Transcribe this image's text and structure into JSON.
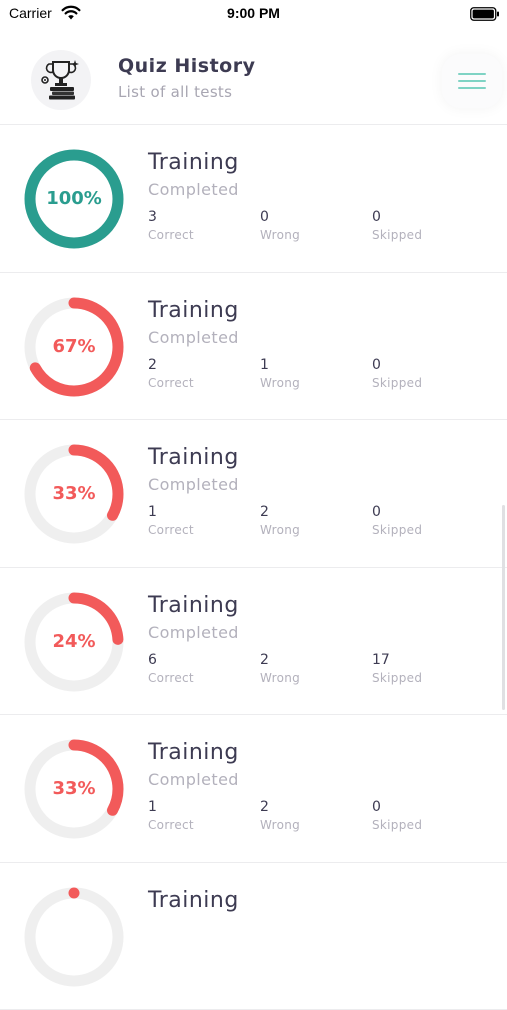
{
  "status": {
    "carrier": "Carrier",
    "time": "9:00 PM"
  },
  "header": {
    "title": "Quiz History",
    "subtitle": "List of all tests"
  },
  "colors": {
    "success": "#2a9d8f",
    "danger": "#f25a5a",
    "track": "#efefef",
    "menu": "#7fd3c4"
  },
  "labels": {
    "correct": "Correct",
    "wrong": "Wrong",
    "skipped": "Skipped"
  },
  "items": [
    {
      "title": "Training",
      "status": "Completed",
      "percent": "100%",
      "progress": 1.0,
      "correct": "3",
      "wrong": "0",
      "skipped": "0"
    },
    {
      "title": "Training",
      "status": "Completed",
      "percent": "67%",
      "progress": 0.67,
      "correct": "2",
      "wrong": "1",
      "skipped": "0"
    },
    {
      "title": "Training",
      "status": "Completed",
      "percent": "33%",
      "progress": 0.33,
      "correct": "1",
      "wrong": "2",
      "skipped": "0"
    },
    {
      "title": "Training",
      "status": "Completed",
      "percent": "24%",
      "progress": 0.24,
      "correct": "6",
      "wrong": "2",
      "skipped": "17"
    },
    {
      "title": "Training",
      "status": "Completed",
      "percent": "33%",
      "progress": 0.33,
      "correct": "1",
      "wrong": "2",
      "skipped": "0"
    },
    {
      "title": "Training",
      "status": "",
      "percent": "",
      "progress": 0.0,
      "correct": "",
      "wrong": "",
      "skipped": ""
    }
  ]
}
